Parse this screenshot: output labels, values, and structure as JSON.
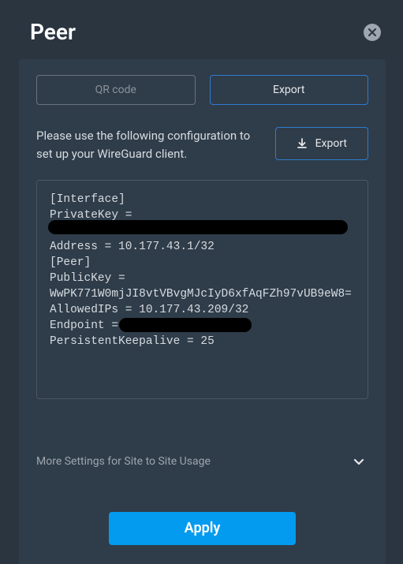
{
  "header": {
    "title": "Peer"
  },
  "tabs": {
    "qr_label": "QR code",
    "export_label": "Export"
  },
  "description": "Please use the following configuration to set up your WireGuard client.",
  "export_button_label": "Export",
  "config": {
    "line1": "[Interface]",
    "line2": "PrivateKey =",
    "line3_redacted": true,
    "line4": "Address = 10.177.43.1/32",
    "line5": "[Peer]",
    "line6": "PublicKey =",
    "line7": "WwPK771W0mjJI8vtVBvgMJcIyD6xfAqFZh97vUB9eW8=",
    "line8": "AllowedIPs = 10.177.43.209/32",
    "line9": "Endpoint =",
    "line9_redacted_trailing": true,
    "line10": "PersistentKeepalive = 25"
  },
  "accordion": {
    "label": "More Settings for Site to Site Usage"
  },
  "apply_button_label": "Apply"
}
